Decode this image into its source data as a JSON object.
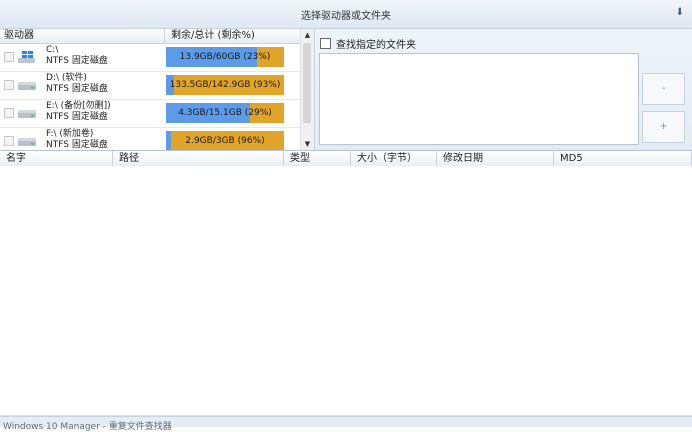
{
  "title_bar": {
    "title": "选择驱动器或文件夹",
    "collapse_icon": "double-chevron-down-icon"
  },
  "drive_panel": {
    "col_drive": "驱动器",
    "col_space": "剩余/总计 (剩余%)",
    "drives": [
      {
        "name": "C:\\",
        "fs": "NTFS 固定磁盘",
        "space": "13.9GB/60GB (23%)",
        "used_fraction": 0.77,
        "icon": "windows-drive-icon"
      },
      {
        "name": "D:\\ (软件)",
        "fs": "NTFS 固定磁盘",
        "space": "133.5GB/142.9GB (93%)",
        "used_fraction": 0.07,
        "icon": "hard-drive-icon"
      },
      {
        "name": "E:\\ (备份[勿删])",
        "fs": "NTFS 固定磁盘",
        "space": "4.3GB/15.1GB (29%)",
        "used_fraction": 0.71,
        "icon": "hard-drive-icon"
      },
      {
        "name": "F:\\ (新加卷)",
        "fs": "NTFS 固定磁盘",
        "space": "2.9GB/3GB (96%)",
        "used_fraction": 0.04,
        "icon": "hard-drive-icon"
      }
    ],
    "colors": {
      "used": "#5b9be8",
      "free": "#e0a428"
    }
  },
  "search_panel": {
    "checkbox_label": "查找指定的文件夹",
    "remove_label": "-",
    "add_label": "+"
  },
  "results": {
    "columns": [
      "名字",
      "路径",
      "类型",
      "大小（字节）",
      "修改日期",
      "MD5"
    ]
  },
  "status_bar": {
    "text": "Windows 10 Manager - 重复文件查找器"
  }
}
